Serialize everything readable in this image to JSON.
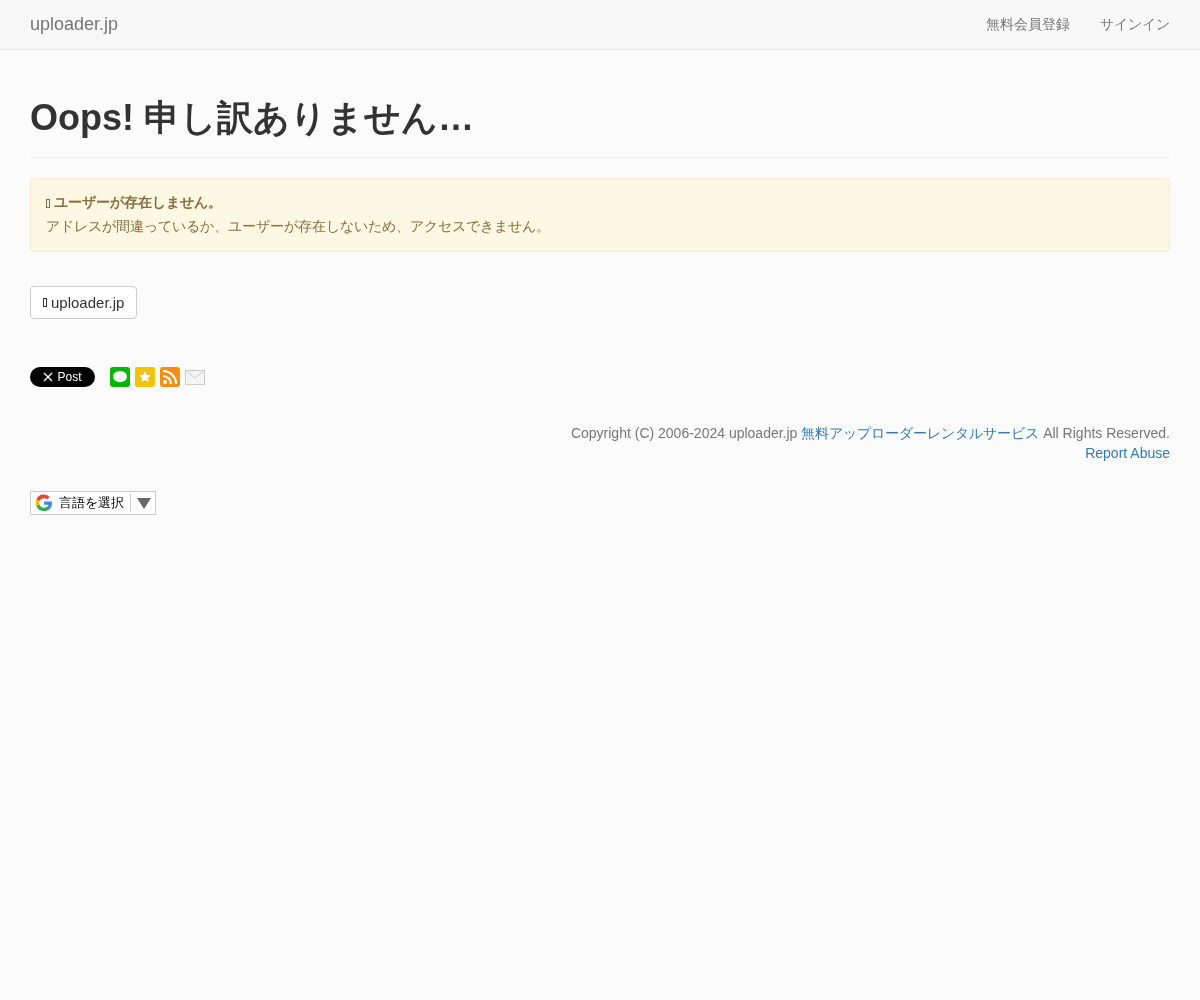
{
  "navbar": {
    "brand": "uploader.jp",
    "links": [
      "無料会員登録",
      "サインイン"
    ]
  },
  "heading": "Oops! 申し訳ありません…",
  "alert": {
    "title": "ユーザーが存在しません。",
    "message": "アドレスが間違っているか、ユーザーが存在しないため、アクセスできません。"
  },
  "home_button": "uploader.jp",
  "share": {
    "post_label": "Post"
  },
  "footer": {
    "copyright_before": "Copyright (C) 2006-2024 uploader.jp",
    "copyright_link": "無料アップローダーレンタルサービス",
    "copyright_after": "All Rights Reserved.",
    "report_link": "Report Abuse"
  },
  "translate": {
    "label": "言語を選択"
  }
}
